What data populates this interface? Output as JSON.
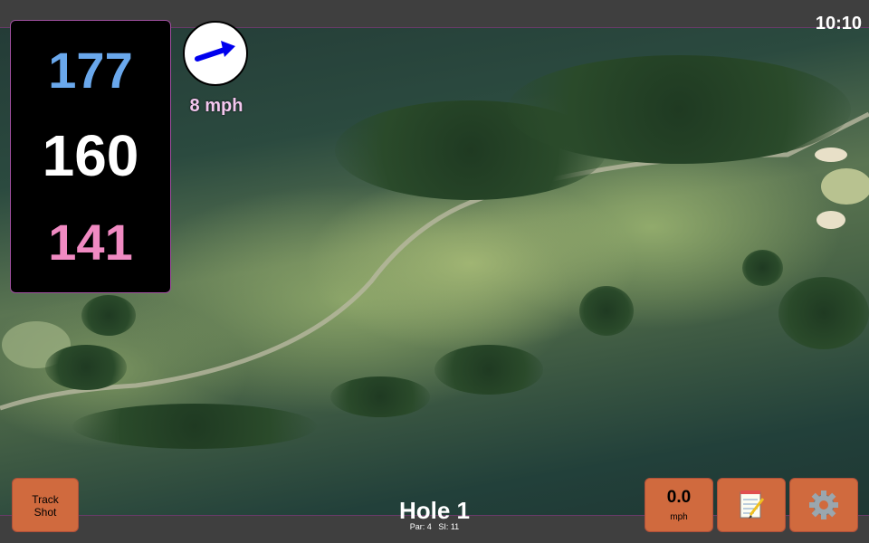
{
  "status": {
    "clock": "10:10"
  },
  "distances": {
    "back": "177",
    "middle": "160",
    "front": "141"
  },
  "wind": {
    "speed": "8 mph",
    "icon": "wind-arrow-icon",
    "arrow_color": "#0000ee"
  },
  "colors": {
    "back_distance": "#6aa8ec",
    "middle_distance": "#ffffff",
    "front_distance": "#f08ac2",
    "button": "#d06a3e",
    "wind_text": "#f3c6ee"
  },
  "controls": {
    "track_shot_line1": "Track",
    "track_shot_line2": "Shot",
    "speed_value": "0.0",
    "speed_unit": "mph",
    "notes_icon": "notepad-icon",
    "settings_icon": "gear-icon"
  },
  "hole": {
    "title": "Hole 1",
    "par": "Par: 4",
    "si": "SI: 11"
  }
}
